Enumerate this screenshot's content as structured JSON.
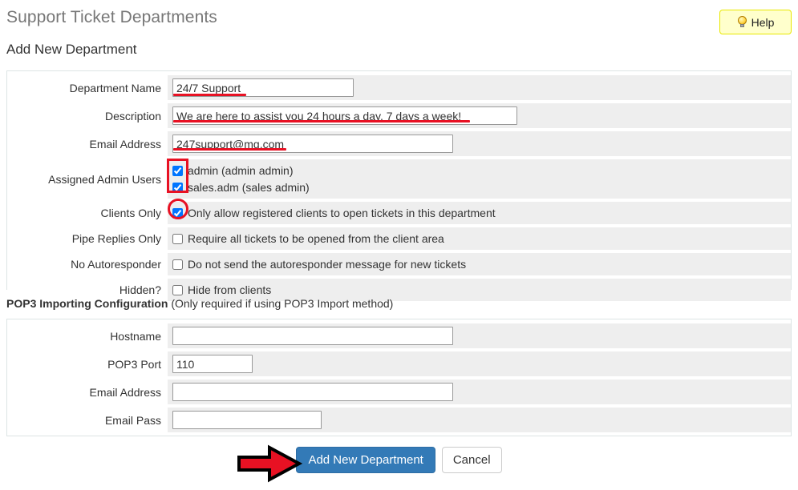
{
  "header": {
    "title": "Support Ticket Departments",
    "subtitle": "Add New Department",
    "help_label": "Help",
    "help_icon": "lightbulb-icon"
  },
  "colors": {
    "title_gray": "#777777",
    "primary_blue": "#337ab7",
    "annotation_red": "#e81123",
    "help_bg": "#ffffcc",
    "help_border": "#e8e800",
    "row_field_bg": "#eeeeee",
    "panel_border": "#dce4e4"
  },
  "main_form": {
    "rows": [
      {
        "label": "Department Name",
        "type": "text",
        "value": "24/7 Support",
        "placeholder": ""
      },
      {
        "label": "Description",
        "type": "text",
        "value": "We are here to assist you 24 hours a day, 7 days a week!",
        "placeholder": ""
      },
      {
        "label": "Email Address",
        "type": "text",
        "value": "247support@mg.com",
        "placeholder": ""
      },
      {
        "label": "Assigned Admin Users",
        "type": "checkbox-group",
        "options": [
          {
            "label": "admin (admin admin)",
            "checked": true
          },
          {
            "label": "sales.adm (sales admin)",
            "checked": true
          }
        ]
      },
      {
        "label": "Clients Only",
        "type": "checkbox",
        "option_label": "Only allow registered clients to open tickets in this department",
        "checked": true
      },
      {
        "label": "Pipe Replies Only",
        "type": "checkbox",
        "option_label": "Require all tickets to be opened from the client area",
        "checked": false
      },
      {
        "label": "No Autoresponder",
        "type": "checkbox",
        "option_label": "Do not send the autoresponder message for new tickets",
        "checked": false
      },
      {
        "label": "Hidden?",
        "type": "checkbox",
        "option_label": "Hide from clients",
        "checked": false
      }
    ]
  },
  "pop3_section": {
    "heading": "POP3 Importing Configuration",
    "heading_note": "(Only required if using POP3 Import method)",
    "rows": [
      {
        "label": "Hostname",
        "value": "",
        "placeholder": ""
      },
      {
        "label": "POP3 Port",
        "value": "110",
        "placeholder": ""
      },
      {
        "label": "Email Address",
        "value": "",
        "placeholder": ""
      },
      {
        "label": "Email Pass",
        "value": "",
        "placeholder": ""
      }
    ]
  },
  "footer": {
    "submit_label": "Add New Department",
    "cancel_label": "Cancel"
  },
  "annotations": {
    "arrow": "red-arrow-pointing-right",
    "rect": "red-rectangle-around-admin-checkboxes",
    "ellipse": "red-circle-around-clients-only-checkbox",
    "underlines": "red-underlines-under-entered-values"
  }
}
